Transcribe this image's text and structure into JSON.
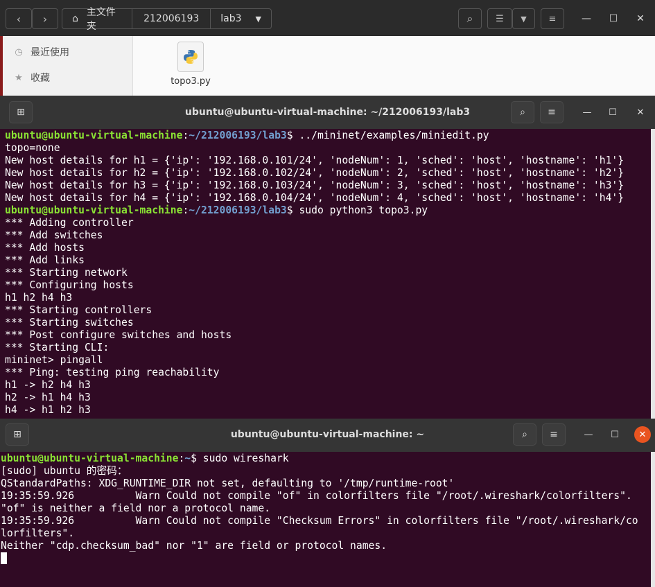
{
  "file_manager": {
    "breadcrumbs": [
      "主文件夹",
      "212006193",
      "lab3"
    ],
    "sidebar": [
      {
        "label": "最近使用",
        "icon": "clock-icon"
      },
      {
        "label": "收藏",
        "icon": "star-icon"
      }
    ],
    "file": {
      "name": "topo3.py",
      "icon": "python-file-icon"
    }
  },
  "terminal1": {
    "title": "ubuntu@ubuntu-virtual-machine: ~/212006193/lab3",
    "lines": [
      {
        "user": "ubuntu@ubuntu-virtual-machine",
        "path": "~/212006193/lab3",
        "cmd": "$ ../mininet/examples/miniedit.py"
      },
      {
        "text": "topo=none"
      },
      {
        "text": "New host details for h1 = {'ip': '192.168.0.101/24', 'nodeNum': 1, 'sched': 'host', 'hostname': 'h1'}"
      },
      {
        "text": "New host details for h2 = {'ip': '192.168.0.102/24', 'nodeNum': 2, 'sched': 'host', 'hostname': 'h2'}"
      },
      {
        "text": "New host details for h3 = {'ip': '192.168.0.103/24', 'nodeNum': 3, 'sched': 'host', 'hostname': 'h3'}"
      },
      {
        "text": "New host details for h4 = {'ip': '192.168.0.104/24', 'nodeNum': 4, 'sched': 'host', 'hostname': 'h4'}"
      },
      {
        "user": "ubuntu@ubuntu-virtual-machine",
        "path": "~/212006193/lab3",
        "cmd": "$ sudo python3 topo3.py"
      },
      {
        "text": "*** Adding controller"
      },
      {
        "text": "*** Add switches"
      },
      {
        "text": "*** Add hosts"
      },
      {
        "text": "*** Add links"
      },
      {
        "text": "*** Starting network"
      },
      {
        "text": "*** Configuring hosts"
      },
      {
        "text": "h1 h2 h4 h3"
      },
      {
        "text": "*** Starting controllers"
      },
      {
        "text": "*** Starting switches"
      },
      {
        "text": "*** Post configure switches and hosts"
      },
      {
        "text": "*** Starting CLI:"
      },
      {
        "text": "mininet> pingall"
      },
      {
        "text": "*** Ping: testing ping reachability"
      },
      {
        "text": "h1 -> h2 h4 h3"
      },
      {
        "text": "h2 -> h1 h4 h3"
      },
      {
        "text": "h4 -> h1 h2 h3"
      }
    ]
  },
  "terminal2": {
    "title": "ubuntu@ubuntu-virtual-machine: ~",
    "lines": [
      {
        "user": "ubuntu@ubuntu-virtual-machine",
        "path": "~",
        "cmd": "$ sudo wireshark"
      },
      {
        "text": "[sudo] ubuntu 的密码："
      },
      {
        "text": "QStandardPaths: XDG_RUNTIME_DIR not set, defaulting to '/tmp/runtime-root'"
      },
      {
        "text": "19:35:59.926          Warn Could not compile \"of\" in colorfilters file \"/root/.wireshark/colorfilters\"."
      },
      {
        "text": "\"of\" is neither a field nor a protocol name."
      },
      {
        "text": "19:35:59.926          Warn Could not compile \"Checksum Errors\" in colorfilters file \"/root/.wireshark/co"
      },
      {
        "text": "lorfilters\"."
      },
      {
        "text": "Neither \"cdp.checksum_bad\" nor \"1\" are field or protocol names."
      }
    ]
  }
}
